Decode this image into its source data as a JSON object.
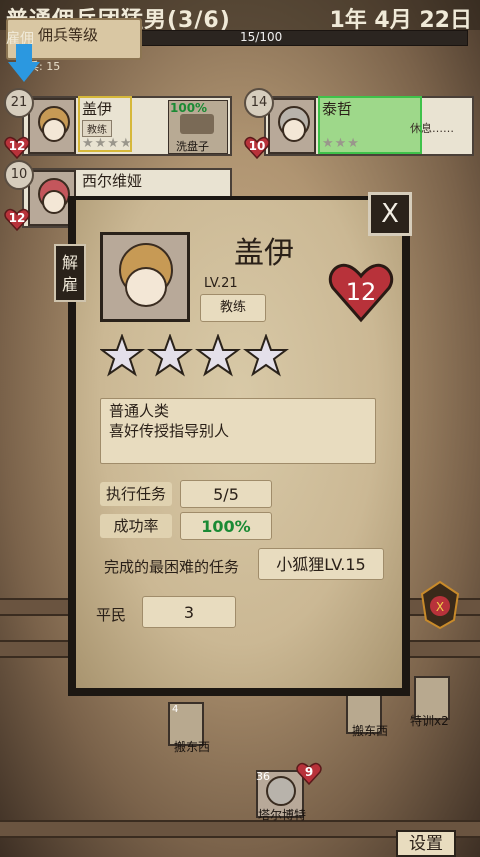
{
  "header": {
    "title": "普通佣兵团猛男(3/6)",
    "date": "1年 4月 22日",
    "xp_text": "15/100",
    "xp_fraction": 0.15,
    "tooltip": "佣兵等级",
    "under_text": "雇佣",
    "small_text": "兵: 15"
  },
  "roster": [
    {
      "level": "21",
      "hearts": "12",
      "name": "盖伊",
      "class": "教练",
      "task_percent": "100%",
      "task_name": "洗盘子",
      "stars": "★★★★"
    },
    {
      "level": "14",
      "hearts": "10",
      "name": "泰哲",
      "status": "休息……",
      "stars": "★★★"
    },
    {
      "level": "10",
      "hearts": "12",
      "name": "西尔维娅"
    }
  ],
  "modal": {
    "close": "X",
    "dismiss_tab": "解雇",
    "name": "盖伊",
    "level": "LV.21",
    "class": "教练",
    "hearts": "12",
    "stars": 4,
    "description_line1": "普通人类",
    "description_line2": "喜好传授指导别人",
    "missions_label": "执行任务",
    "missions_value": "5/5",
    "success_label": "成功率",
    "success_value": "100%",
    "hardest_label": "完成的最困难的任务",
    "hardest_value": "小狐狸LV.15",
    "rank_label": "平民",
    "rank_value": "3"
  },
  "board": {
    "task1_count": "4",
    "task1_label": "搬东西",
    "task2_label": "搬东西",
    "task3_label": "特训x2",
    "merc_level": "36",
    "merc_hearts": "9",
    "merc_name": "塔尔博特"
  },
  "footer": {
    "settings": "设置"
  },
  "colors": {
    "accent_green": "#1a8a34",
    "heart_red": "#b8323a",
    "arrow_blue": "#2b98e0"
  }
}
